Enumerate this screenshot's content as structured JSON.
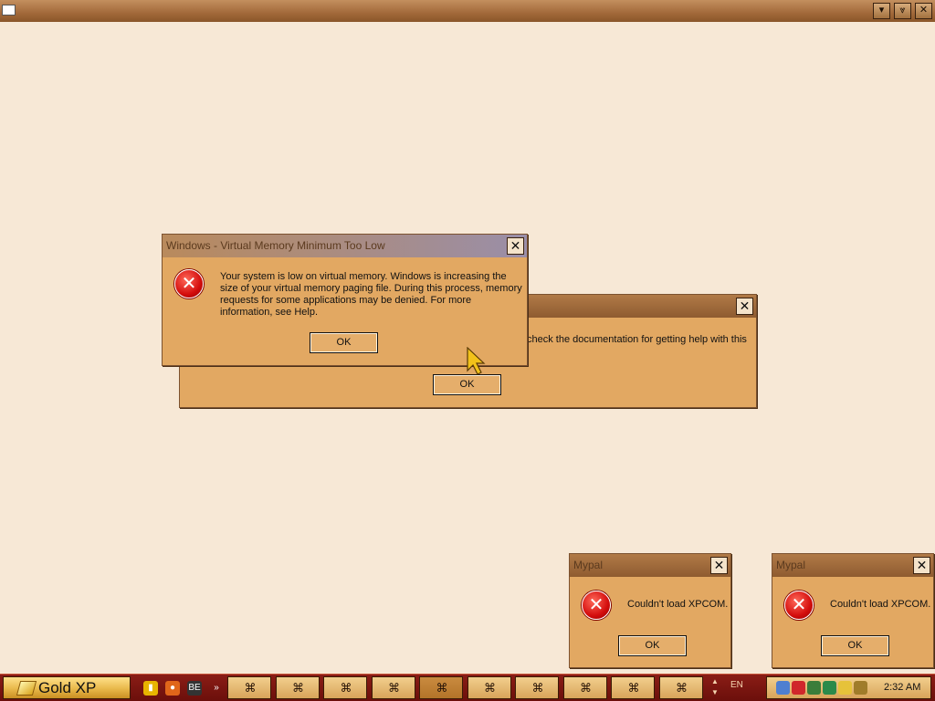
{
  "topbar": {
    "controls": [
      {
        "name": "minimize-icon",
        "glyph": "▾"
      },
      {
        "name": "chevron-down-icon",
        "glyph": "⩔"
      },
      {
        "name": "close-icon",
        "glyph": "✕"
      }
    ]
  },
  "back_dialog": {
    "text": "check the documentation for getting help with this",
    "ok_label": "OK",
    "close_glyph": "✕"
  },
  "vm_dialog": {
    "title": "Windows - Virtual Memory Minimum Too Low",
    "message": "Your system is low on virtual memory. Windows is increasing the size of your virtual memory paging file. During this process, memory requests for some applications may be denied. For more information, see Help.",
    "ok_label": "OK",
    "close_glyph": "✕",
    "icon_glyph": "✕"
  },
  "mypal_dialogs": [
    {
      "title": "Mypal",
      "message": "Couldn't load XPCOM.",
      "ok_label": "OK",
      "close_glyph": "✕",
      "icon_glyph": "✕"
    },
    {
      "title": "Mypal",
      "message": "Couldn't load XPCOM.",
      "ok_label": "OK",
      "close_glyph": "✕",
      "icon_glyph": "✕"
    }
  ],
  "taskbar": {
    "start_label": "Gold XP",
    "quick_launch": [
      {
        "name": "folder-icon",
        "color": "#e8b400",
        "glyph": "▮"
      },
      {
        "name": "firefox-icon",
        "color": "#e0661a",
        "glyph": "●"
      },
      {
        "name": "media-icon",
        "color": "#333333",
        "glyph": "BE"
      },
      {
        "name": "chevron-right-icon",
        "color": "transparent",
        "glyph": "»"
      }
    ],
    "task_count": 10,
    "task_glyph": "⌘",
    "scroll_up": "▲",
    "scroll_down": "▼",
    "language": "EN",
    "tray_icons": [
      {
        "name": "network-icon",
        "color": "#4f7fd0"
      },
      {
        "name": "security-shield-icon",
        "color": "#d0272b"
      },
      {
        "name": "user-icon",
        "color": "#3a7d3a"
      },
      {
        "name": "globe-icon",
        "color": "#2b8a4a"
      },
      {
        "name": "smiley-icon",
        "color": "#e6c23a"
      },
      {
        "name": "wrench-icon",
        "color": "#a07c2a"
      }
    ],
    "clock": "2:32 AM"
  },
  "colors": {
    "desktop": "#f7e8d6",
    "dialog_body": "#e2a862",
    "taskbar": "#7a1510"
  }
}
